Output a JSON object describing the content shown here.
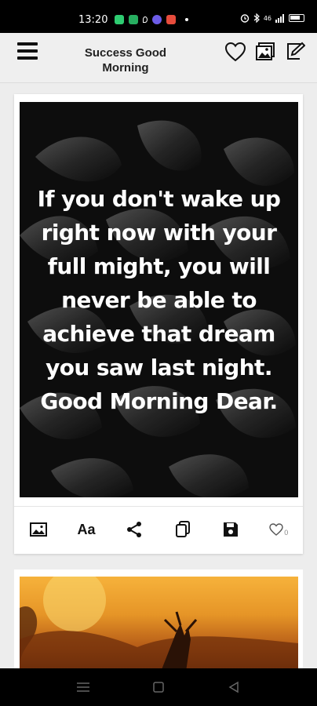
{
  "status": {
    "time": "13:20",
    "signal_text": "46"
  },
  "app_bar": {
    "title": "Success Good Morning"
  },
  "quote_card": {
    "quote": "If you don't wake up right now with your full might, you will never be able to achieve that dream you saw last night. Good Morning Dear.",
    "actions": {
      "image_icon": "image-icon",
      "font_label": "Aa",
      "share_icon": "share-icon",
      "copy_icon": "copy-icon",
      "save_icon": "save-icon",
      "like_icon": "heart-icon",
      "like_count": "0"
    }
  },
  "icons": {
    "menu": "menu-icon",
    "favorite": "heart-icon",
    "gallery": "gallery-icon",
    "edit": "edit-icon"
  },
  "colors": {
    "app_bar_bg": "#efefef",
    "status_bar_bg": "#000000",
    "quote_bg": "#0c0c0c",
    "quote_text": "#ffffff"
  }
}
